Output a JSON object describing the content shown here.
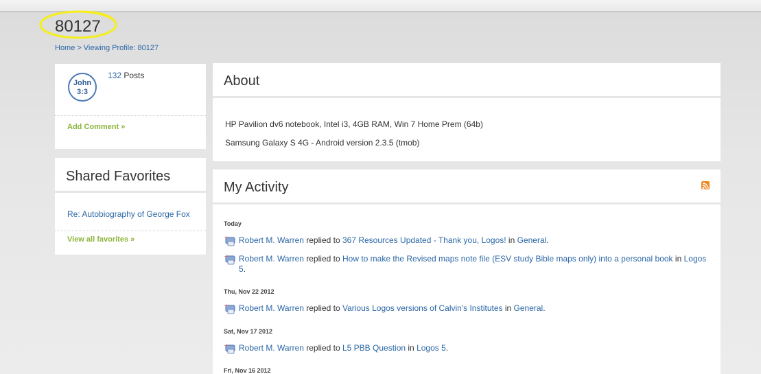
{
  "profile_id": "80127",
  "breadcrumb": {
    "home": "Home",
    "sep": ">",
    "current": "Viewing Profile: 80127"
  },
  "profile": {
    "avatar_line1": "John",
    "avatar_line2": "3:3",
    "post_count": "132",
    "posts_label": "Posts",
    "add_comment": "Add Comment »"
  },
  "shared_favorites": {
    "title": "Shared Favorites",
    "items": [
      "Re: Autobiography of George Fox"
    ],
    "view_all": "View all favorites »"
  },
  "about": {
    "title": "About",
    "lines": [
      "HP Pavilion dv6 notebook, Intel i3, 4GB RAM, Win 7 Home Prem (64b)",
      "Samsung Galaxy S 4G - Android version 2.3.5 (tmob)"
    ]
  },
  "activity": {
    "title": "My Activity",
    "groups": [
      {
        "day": "Today",
        "entries": [
          {
            "user": "Robert M. Warren",
            "verb": "replied to",
            "thread": "367 Resources Updated - Thank you, Logos!",
            "in": "in",
            "forum": "General",
            "end": "."
          },
          {
            "user": "Robert M. Warren",
            "verb": "replied to",
            "thread": "How to make the Revised maps note file (ESV study Bible maps only) into a personal book",
            "in": "in",
            "forum": "Logos 5",
            "end": "."
          }
        ]
      },
      {
        "day": "Thu, Nov 22 2012",
        "entries": [
          {
            "user": "Robert M. Warren",
            "verb": "replied to",
            "thread": "Various Logos versions of Calvin's Institutes",
            "in": "in",
            "forum": "General",
            "end": "."
          }
        ]
      },
      {
        "day": "Sat, Nov 17 2012",
        "entries": [
          {
            "user": "Robert M. Warren",
            "verb": "replied to",
            "thread": "L5 PBB Question",
            "in": "in",
            "forum": "Logos 5",
            "end": "."
          }
        ]
      },
      {
        "day": "Fri, Nov 16 2012",
        "entries": []
      }
    ]
  },
  "colors": {
    "link": "#2b67a6",
    "accent_green": "#8bb33a",
    "highlight": "#f5ee1a",
    "rss": "#f08a24"
  }
}
